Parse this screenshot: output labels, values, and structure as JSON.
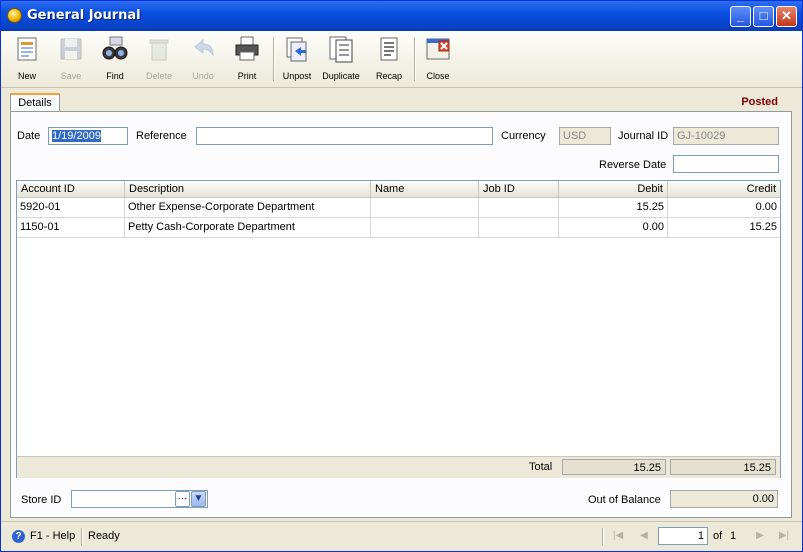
{
  "window": {
    "title": "General Journal"
  },
  "toolbar": {
    "new": "New",
    "save": "Save",
    "find": "Find",
    "delete": "Delete",
    "undo": "Undo",
    "print": "Print",
    "unpost": "Unpost",
    "duplicate": "Duplicate",
    "recap": "Recap",
    "close": "Close"
  },
  "tab": {
    "details": "Details"
  },
  "status_text": "Posted",
  "form": {
    "date_label": "Date",
    "date_value": "1/19/2009",
    "reference_label": "Reference",
    "reference_value": "",
    "currency_label": "Currency",
    "currency_value": "USD",
    "journal_id_label": "Journal ID",
    "journal_id_value": "GJ-10029",
    "reverse_date_label": "Reverse Date",
    "reverse_date_value": ""
  },
  "grid": {
    "columns": [
      "Account ID",
      "Description",
      "Name",
      "Job ID",
      "Debit",
      "Credit"
    ],
    "rows": [
      [
        "5920-01",
        "Other Expense-Corporate Department",
        "",
        "",
        "15.25",
        "0.00"
      ],
      [
        "1150-01",
        "Petty Cash-Corporate Department",
        "",
        "",
        "0.00",
        "15.25"
      ]
    ],
    "total_label": "Total",
    "total_debit": "15.25",
    "total_credit": "15.25"
  },
  "footer": {
    "store_id_label": "Store ID",
    "store_id_value": "",
    "out_of_balance_label": "Out of Balance",
    "out_of_balance_value": "0.00"
  },
  "statusbar": {
    "help": "F1 - Help",
    "state": "Ready",
    "page": "1",
    "of_label": "of",
    "page_count": "1"
  }
}
